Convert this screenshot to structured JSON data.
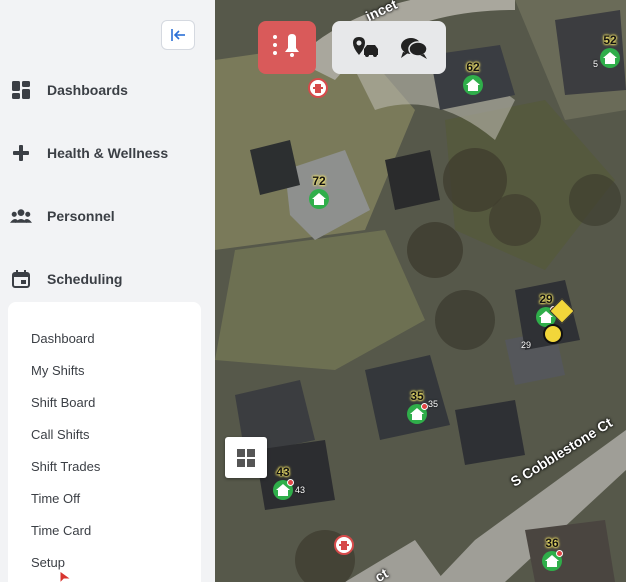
{
  "sidebar": {
    "collapse_icon": "collapse-left-icon",
    "items": [
      {
        "label": "Dashboards",
        "icon": "dashboard-grid-icon"
      },
      {
        "label": "Health & Wellness",
        "icon": "plus-icon"
      },
      {
        "label": "Personnel",
        "icon": "people-icon"
      },
      {
        "label": "Scheduling",
        "icon": "calendar-icon"
      }
    ],
    "scheduling_submenu": [
      "Dashboard",
      "My Shifts",
      "Shift Board",
      "Call Shifts",
      "Shift Trades",
      "Time Off",
      "Time Card",
      "Setup"
    ]
  },
  "map": {
    "toolbar": {
      "alert_icon": "alert-bell-icon",
      "vehicle_location_icon": "location-car-icon",
      "chat_icon": "chat-icon"
    },
    "layers_icon": "layers-grid-icon",
    "streets": [
      "S Cobblestone Ct",
      "ct",
      "incet"
    ],
    "markers": {
      "m62": "62",
      "m52": "52",
      "m52_small": "5",
      "m72": "72",
      "m29": "29",
      "m29_small": "29",
      "m35": "35",
      "m35_small": "35",
      "m43": "43",
      "m43_small": "43",
      "m36": "36"
    }
  },
  "colors": {
    "sidebar_bg": "#f2f3f5",
    "alert_red": "#d95a5a",
    "marker_green": "#2fae4a",
    "marker_label_yellow": "#f7e86a"
  }
}
